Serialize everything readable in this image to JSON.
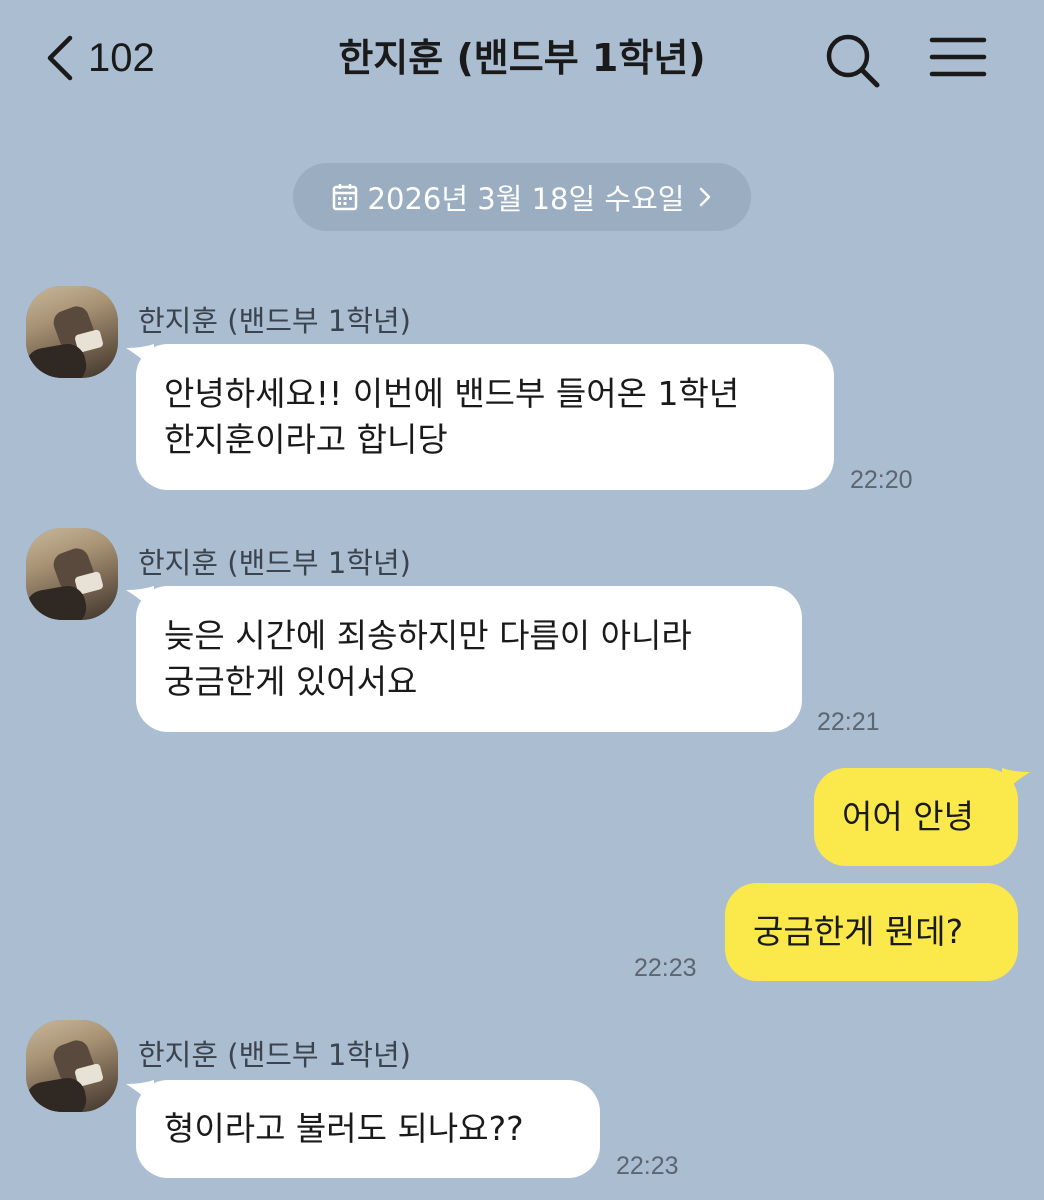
{
  "header": {
    "back_count": "102",
    "title": "한지훈 (밴드부 1학년)"
  },
  "date_divider": {
    "label": "2026년 3월 18일 수요일"
  },
  "messages": [
    {
      "sender": "한지훈 (밴드부 1학년)",
      "lines": [
        "안녕하세요!! 이번에 밴드부 들어온 1학년",
        "한지훈이라고 합니당"
      ],
      "time": "22:20"
    },
    {
      "sender": "한지훈 (밴드부 1학년)",
      "lines": [
        "늦은 시간에 죄송하지만 다름이 아니라",
        "궁금한게 있어서요"
      ],
      "time": "22:21"
    },
    {
      "lines": [
        "어어 안녕"
      ]
    },
    {
      "lines": [
        "궁금한게 뭔데?"
      ],
      "time": "22:23"
    },
    {
      "sender": "한지훈 (밴드부 1학년)",
      "lines": [
        "형이라고 불러도 되나요??"
      ],
      "time": "22:23"
    }
  ],
  "colors": {
    "background": "#abbdd0",
    "incoming_bubble": "#ffffff",
    "outgoing_bubble": "#fbe84b",
    "date_pill": "#9aadc1"
  },
  "icons": [
    "chevron-left-icon",
    "search-icon",
    "menu-icon",
    "calendar-icon",
    "chevron-right-icon",
    "avatar"
  ]
}
